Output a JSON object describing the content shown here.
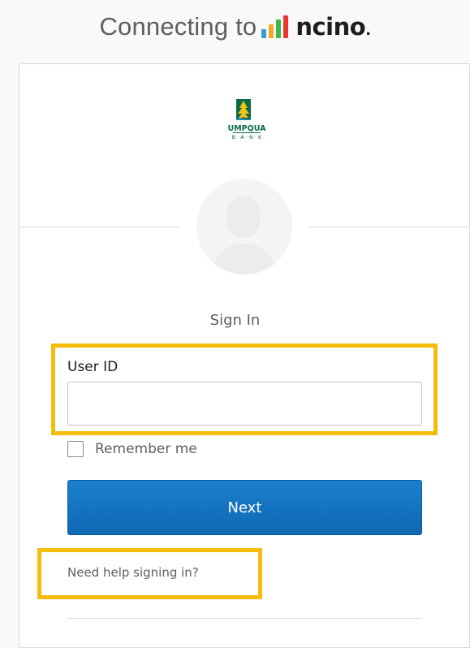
{
  "header": {
    "prefix": "Connecting to",
    "brand_name": "ncino",
    "brand_suffix": ".",
    "brand_bar_colors": [
      "#2b9fd6",
      "#f5a623",
      "#3eb649",
      "#e8372d"
    ]
  },
  "bank_logo": {
    "name_line1": "UMPQUA",
    "name_line2": "B · A · N · K",
    "colors": {
      "green": "#0a6a45",
      "tree": "#f2c11a"
    }
  },
  "form": {
    "title": "Sign In",
    "user_id_label": "User ID",
    "user_id_value": "",
    "remember_label": "Remember me",
    "remember_checked": false,
    "next_label": "Next",
    "help_link": "Need help signing in?"
  },
  "colors": {
    "accent": "#1774c0",
    "highlight": "#f5bd0b"
  }
}
